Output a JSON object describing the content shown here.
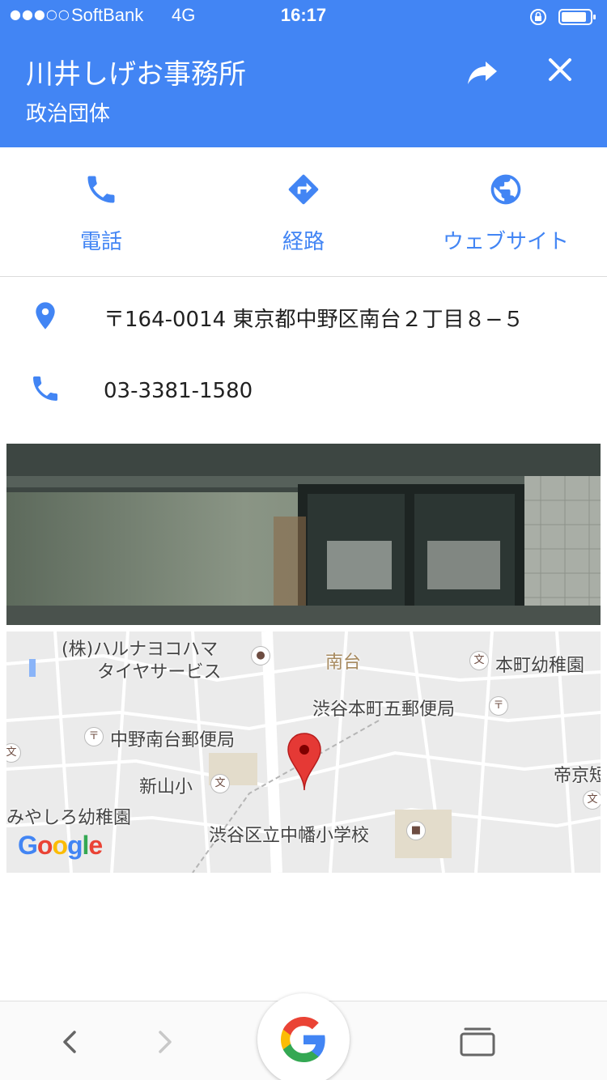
{
  "status_bar": {
    "signal": "●●●○○",
    "carrier": "SoftBank",
    "network": "4G",
    "time": "16:17"
  },
  "header": {
    "title": "川井しげお事務所",
    "subtitle": "政治団体",
    "share_icon": "share-icon",
    "close_icon": "close-icon"
  },
  "actions": [
    {
      "label": "電話",
      "icon": "phone-icon"
    },
    {
      "label": "経路",
      "icon": "directions-icon"
    },
    {
      "label": "ウェブサイト",
      "icon": "globe-icon"
    }
  ],
  "info": {
    "address": "〒164-0014 東京都中野区南台２丁目８−５",
    "phone": "03-3381-1580"
  },
  "map": {
    "labels": {
      "company": "(株)ハルナヨコハマ",
      "company2": "タイヤサービス",
      "area": "南台",
      "kindergarten1": "本町幼稚園",
      "postoffice1": "渋谷本町五郵便局",
      "postoffice2": "中野南台郵便局",
      "school1": "新山小",
      "school_cut": "帝京短",
      "kindergarten2": "みやしろ幼稚園",
      "school2": "渋谷区立中幡小学校",
      "poi_school": "文",
      "poi_post": "〒"
    },
    "brand": "Google"
  },
  "colors": {
    "accent": "#4285f4",
    "pin": "#e53935"
  }
}
